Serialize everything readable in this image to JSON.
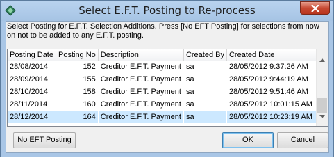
{
  "window": {
    "title": "Select E.F.T. Posting to Re-process"
  },
  "instructions": "Select Posting for E.F.T. Selection Additions.  Press [No EFT Posting] for selections from now on not to be added to any E.F.T. posting.",
  "table": {
    "columns": [
      "Posting Date",
      "Posting No",
      "Description",
      "Created By",
      "Created Date"
    ],
    "rows": [
      [
        "28/08/2014",
        "152",
        "Creditor E.F.T. Payment",
        "sa",
        "28/05/2012 9:37:26 AM"
      ],
      [
        "28/09/2014",
        "155",
        "Creditor E.F.T. Payment",
        "sa",
        "28/05/2012 9:44:19 AM"
      ],
      [
        "28/10/2014",
        "158",
        "Creditor E.F.T. Payment",
        "sa",
        "28/05/2012 9:51:46 AM"
      ],
      [
        "28/11/2014",
        "160",
        "Creditor E.F.T. Payment",
        "sa",
        "28/05/2012 10:01:15 AM"
      ],
      [
        "28/12/2014",
        "164",
        "Creditor E.F.T. Payment",
        "sa",
        "28/05/2012 10:23:19 AM"
      ]
    ],
    "selected_row": 4
  },
  "buttons": {
    "no_eft": "No EFT Posting",
    "ok": "OK",
    "cancel": "Cancel"
  },
  "colors": {
    "selection": "#cce8ff",
    "title_bar": "#a9c6e6",
    "close_button": "#c74a33"
  }
}
